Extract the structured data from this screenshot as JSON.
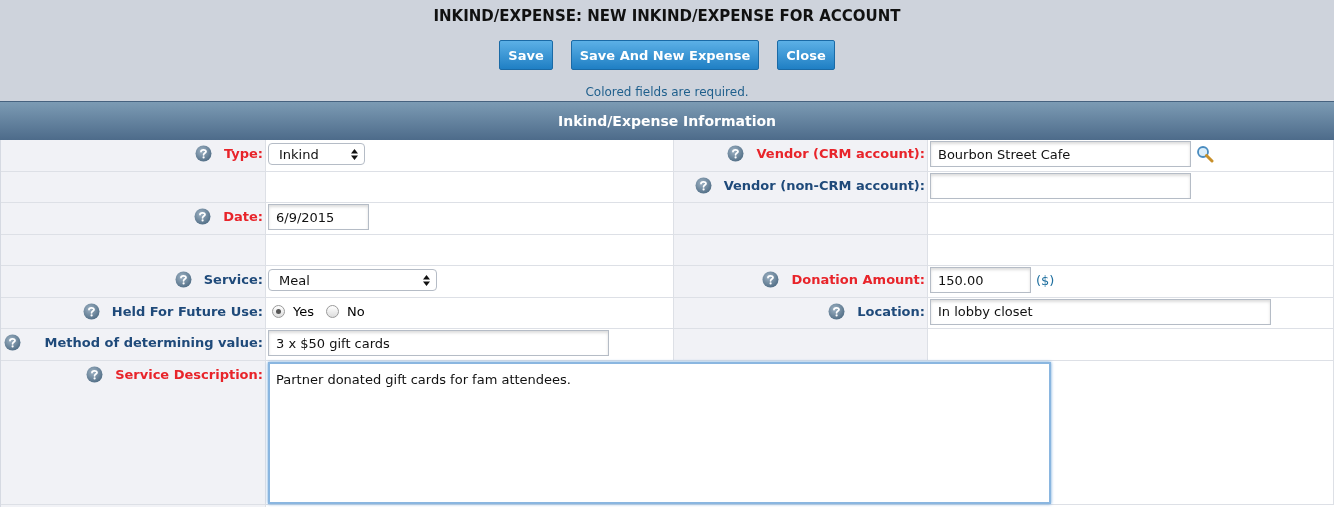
{
  "title": "INKIND/EXPENSE: NEW INKIND/EXPENSE FOR ACCOUNT",
  "buttons": [
    "Save",
    "Save And New Expense",
    "Close"
  ],
  "note": "Colored fields are required.",
  "section": "Inkind/Expense Information",
  "rows": [
    {
      "left": {
        "label": "Type:",
        "required": true,
        "kind": "select",
        "value": "Inkind"
      },
      "right": {
        "label": "Vendor (CRM account):",
        "required": true,
        "kind": "lookup",
        "value": "Bourbon Street Cafe"
      }
    },
    {
      "right": {
        "label": "Vendor (non-CRM account):",
        "required": false,
        "kind": "text"
      }
    },
    {
      "left": {
        "label": "Date:",
        "required": true,
        "kind": "text",
        "value": "6/9/2015"
      }
    },
    {},
    {
      "left": {
        "label": "Service:",
        "required": false,
        "kind": "select",
        "value": "Meal"
      },
      "right": {
        "label": "Donation Amount:",
        "required": true,
        "kind": "text",
        "value": "150.00",
        "unit": "($)"
      }
    },
    {
      "left": {
        "label": "Held For Future Use:",
        "required": false,
        "kind": "radio",
        "options": [
          {
            "label": "Yes",
            "selected": true
          },
          {
            "label": "No",
            "selected": false
          }
        ]
      },
      "right": {
        "label": "Location:",
        "required": false,
        "kind": "text",
        "value": "In lobby closet"
      }
    },
    {
      "left": {
        "label": "Method of determining value:",
        "required": false,
        "kind": "text",
        "value": "3 x $50 gift cards"
      }
    },
    {
      "left": {
        "label": "Service Description:",
        "required": true,
        "kind": "textarea",
        "value": "Partner donated gift cards for fam attendees."
      }
    }
  ]
}
